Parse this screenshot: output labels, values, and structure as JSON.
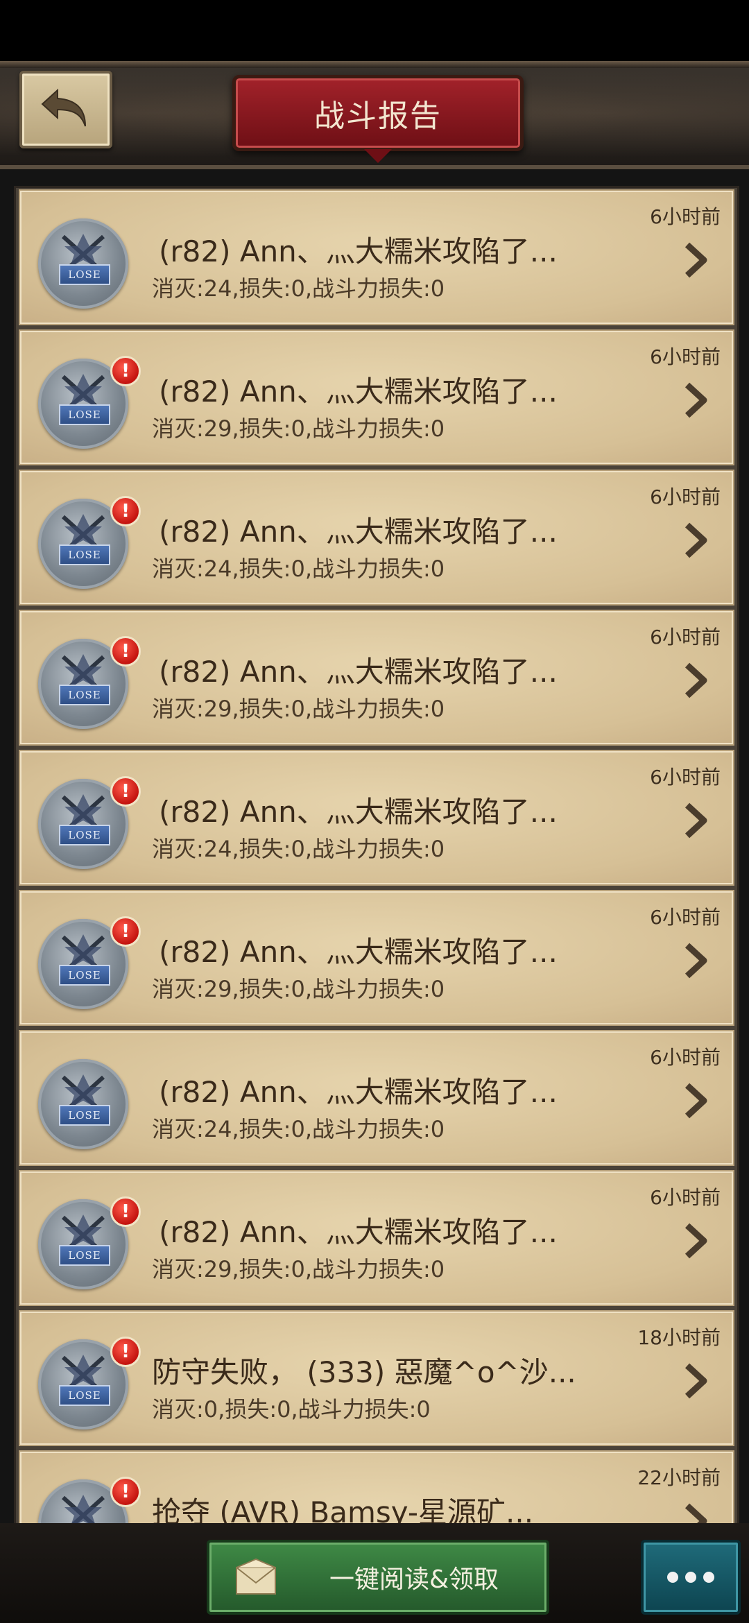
{
  "header": {
    "title": "战斗报告"
  },
  "reports": [
    {
      "title": "(r82) Ann、灬大糯米攻陷了...",
      "stats": "消灭:24,损失:0,战斗力损失:0",
      "time": "6小时前",
      "unread": false
    },
    {
      "title": "(r82) Ann、灬大糯米攻陷了...",
      "stats": "消灭:29,损失:0,战斗力损失:0",
      "time": "6小时前",
      "unread": true
    },
    {
      "title": "(r82) Ann、灬大糯米攻陷了...",
      "stats": "消灭:24,损失:0,战斗力损失:0",
      "time": "6小时前",
      "unread": true
    },
    {
      "title": "(r82) Ann、灬大糯米攻陷了...",
      "stats": "消灭:29,损失:0,战斗力损失:0",
      "time": "6小时前",
      "unread": true
    },
    {
      "title": "(r82) Ann、灬大糯米攻陷了...",
      "stats": "消灭:24,损失:0,战斗力损失:0",
      "time": "6小时前",
      "unread": true
    },
    {
      "title": "(r82) Ann、灬大糯米攻陷了...",
      "stats": "消灭:29,损失:0,战斗力损失:0",
      "time": "6小时前",
      "unread": true
    },
    {
      "title": "(r82) Ann、灬大糯米攻陷了...",
      "stats": "消灭:24,损失:0,战斗力损失:0",
      "time": "6小时前",
      "unread": false
    },
    {
      "title": "(r82) Ann、灬大糯米攻陷了...",
      "stats": "消灭:29,损失:0,战斗力损失:0",
      "time": "6小时前",
      "unread": true
    },
    {
      "title": "防守失败， (333) 惡魔^o^沙...",
      "stats": "消灭:0,损失:0,战斗力损失:0",
      "time": "18小时前",
      "unread": true
    },
    {
      "title": "抢夺 (AVR) Bamsy-星源矿...",
      "stats": "",
      "time": "22小时前",
      "unread": true
    }
  ],
  "badge_label": "LOSE",
  "footer": {
    "read_all_label": "一键阅读&领取"
  },
  "colors": {
    "title_red": "#a2222a",
    "parchment": "#e6d4ad",
    "green_button": "#3f8a46",
    "teal_button": "#1f6b7a",
    "alert_red": "#c4140f"
  }
}
